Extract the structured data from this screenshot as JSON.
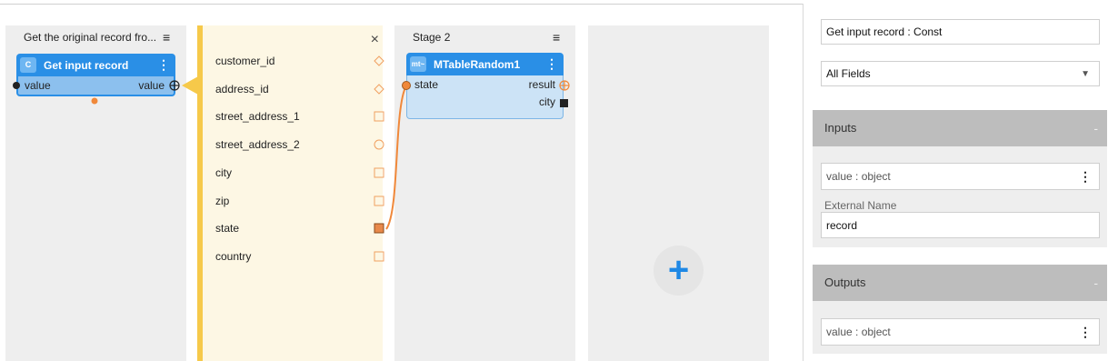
{
  "stage1": {
    "title": "Get the original record fro...",
    "menu_icon": "≡",
    "node": {
      "badge": "C",
      "name": "Get input record",
      "input_port": "value",
      "output_port": "value"
    }
  },
  "field_list": {
    "close_icon": "×",
    "fields": [
      {
        "name": "customer_id",
        "icon": "diamond"
      },
      {
        "name": "address_id",
        "icon": "diamond"
      },
      {
        "name": "street_address_1",
        "icon": "square"
      },
      {
        "name": "street_address_2",
        "icon": "circle"
      },
      {
        "name": "city",
        "icon": "square"
      },
      {
        "name": "zip",
        "icon": "square"
      },
      {
        "name": "state",
        "icon": "square-filled"
      },
      {
        "name": "country",
        "icon": "square"
      }
    ]
  },
  "stage2": {
    "title": "Stage 2",
    "menu_icon": "≡",
    "node": {
      "badge": "mt~",
      "name": "MTableRandom1",
      "input_port": "state",
      "output_ports": [
        "result",
        "city"
      ]
    }
  },
  "add_stage": {
    "icon": "+"
  },
  "panel": {
    "node_title": "Get input record : Const",
    "fields_select": "All Fields",
    "inputs": {
      "header": "Inputs",
      "collapse_icon": "-",
      "param": "value : object",
      "external_name_label": "External Name",
      "external_name_value": "record"
    },
    "outputs": {
      "header": "Outputs",
      "collapse_icon": "-",
      "param": "value : object"
    }
  },
  "colors": {
    "accent": "#2a8fe6",
    "wire": "#f0883a",
    "field_panel_border": "#f6c94a"
  }
}
